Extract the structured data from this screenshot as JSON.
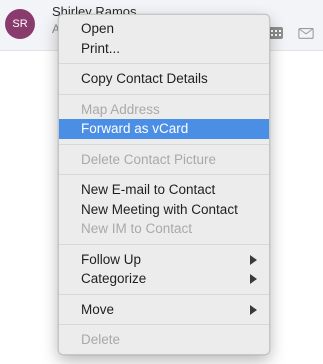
{
  "contact": {
    "initials": "SR",
    "name": "Shirley Ramos",
    "sub_visible": "A"
  },
  "colors": {
    "avatar": "#8a3b6e",
    "highlight": "#4b8ee5",
    "menu_bg": "#ececec"
  },
  "menu": {
    "open": "Open",
    "print": "Print...",
    "copy_contact_details": "Copy Contact Details",
    "map_address": "Map Address",
    "forward_as_vcard": "Forward as vCard",
    "delete_contact_picture": "Delete Contact Picture",
    "new_email_to_contact": "New E-mail to Contact",
    "new_meeting_with_contact": "New Meeting with Contact",
    "new_im_to_contact": "New IM to Contact",
    "follow_up": "Follow Up",
    "categorize": "Categorize",
    "move": "Move",
    "delete": "Delete"
  },
  "icons": {
    "calendar": "calendar-icon",
    "mail": "mail-icon",
    "submenu": "chevron-right-icon"
  }
}
